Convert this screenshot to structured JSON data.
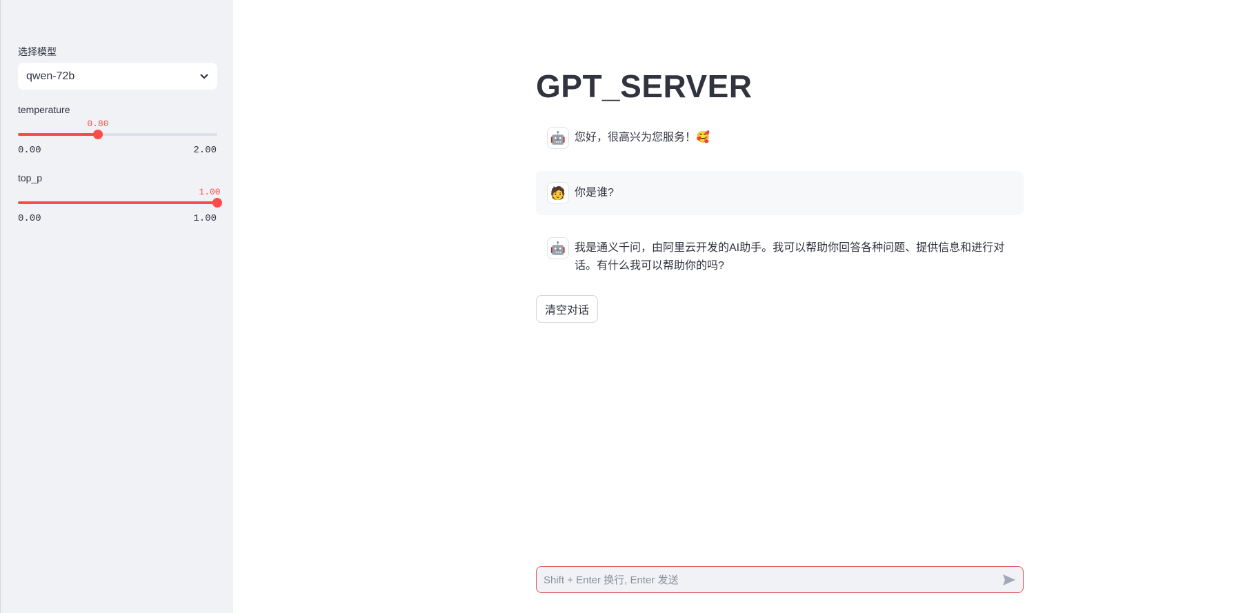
{
  "sidebar": {
    "model_label": "选择模型",
    "model_value": "qwen-72b",
    "temperature": {
      "label": "temperature",
      "value": "0.80",
      "min": "0.00",
      "max": "2.00",
      "fraction": 0.4
    },
    "top_p": {
      "label": "top_p",
      "value": "1.00",
      "min": "0.00",
      "max": "1.00",
      "fraction": 1.0
    }
  },
  "main": {
    "title": "GPT_SERVER",
    "messages": [
      {
        "role": "assistant",
        "avatar": "🤖",
        "text": "您好，很高兴为您服务！🥰"
      },
      {
        "role": "user",
        "avatar": "🧑",
        "text": "你是谁?"
      },
      {
        "role": "assistant",
        "avatar": "🤖",
        "text": "我是通义千问，由阿里云开发的AI助手。我可以帮助你回答各种问题、提供信息和进行对话。有什么我可以帮助你的吗?"
      }
    ],
    "clear_button": "清空对话",
    "input_placeholder": "Shift + Enter 换行, Enter 发送"
  },
  "colors": {
    "accent": "#ff4b4b",
    "sidebar_bg": "#f0f2f6"
  }
}
